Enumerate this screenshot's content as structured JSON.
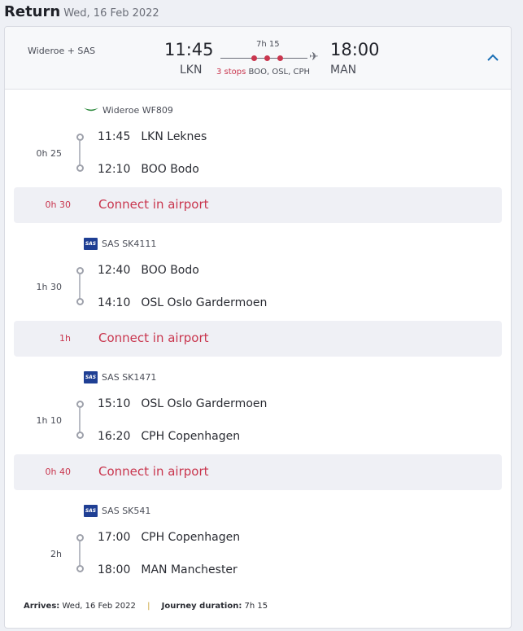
{
  "header": {
    "title": "Return",
    "date": "Wed, 16 Feb 2022"
  },
  "summary": {
    "airlines": "Wideroe + SAS",
    "departure_time": "11:45",
    "departure_code": "LKN",
    "arrival_time": "18:00",
    "arrival_code": "MAN",
    "duration": "7h 15",
    "stops_count": "3 stops",
    "stops_list": "BOO, OSL, CPH"
  },
  "legs": [
    {
      "carrier": "Wideroe WF809",
      "duration": "0h 25",
      "dep_time": "11:45",
      "dep_place": "LKN Leknes",
      "arr_time": "12:10",
      "arr_place": "BOO Bodo"
    },
    {
      "carrier": "SAS SK4111",
      "duration": "1h 30",
      "dep_time": "12:40",
      "dep_place": "BOO Bodo",
      "arr_time": "14:10",
      "arr_place": "OSL Oslo Gardermoen"
    },
    {
      "carrier": "SAS SK1471",
      "duration": "1h 10",
      "dep_time": "15:10",
      "dep_place": "OSL Oslo Gardermoen",
      "arr_time": "16:20",
      "arr_place": "CPH Copenhagen"
    },
    {
      "carrier": "SAS SK541",
      "duration": "2h",
      "dep_time": "17:00",
      "dep_place": "CPH Copenhagen",
      "arr_time": "18:00",
      "arr_place": "MAN Manchester"
    }
  ],
  "connections": [
    {
      "duration": "0h 30",
      "label": "Connect in airport"
    },
    {
      "duration": "1h",
      "label": "Connect in airport"
    },
    {
      "duration": "0h 40",
      "label": "Connect in airport"
    }
  ],
  "footer": {
    "arrives_label": "Arrives:",
    "arrives_value": "Wed, 16 Feb 2022",
    "separator": "|",
    "journey_label": "Journey duration:",
    "journey_value": "7h 15"
  },
  "colors": {
    "accent": "#c9364e",
    "link": "#1a6fb5",
    "sas_blue": "#1f3f94",
    "wideroe_green": "#2e8b3e"
  },
  "icons": {
    "collapse": "chevron-up-icon",
    "plane": "airplane-icon"
  }
}
